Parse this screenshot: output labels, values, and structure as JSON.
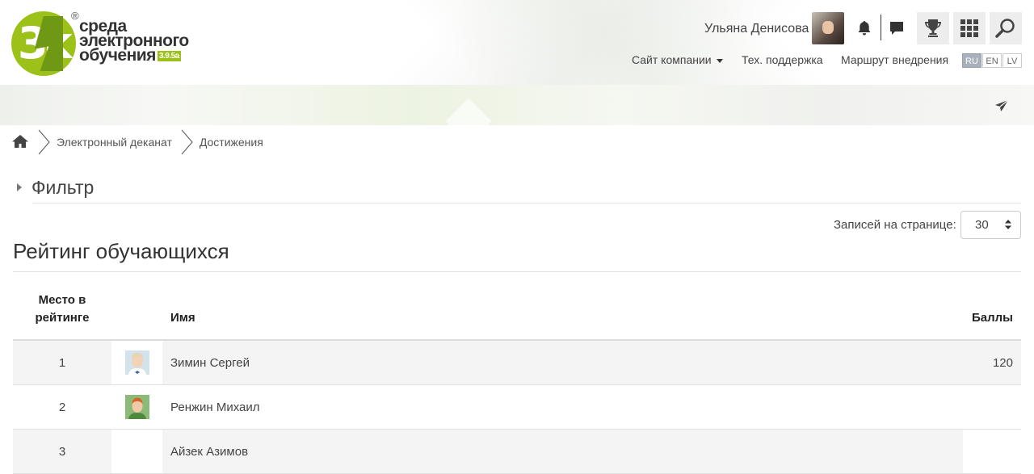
{
  "header": {
    "logo": {
      "line1": "среда",
      "line2": "электронного",
      "line3": "обучения",
      "version": "3.9.5a",
      "mark": "3k",
      "reg": "®"
    },
    "user_name": "Ульяна Денисова",
    "icons": [
      "bell-icon",
      "chat-icon",
      "trophy-icon",
      "grid-icon",
      "search-icon"
    ],
    "nav": {
      "company_site": "Сайт компании",
      "support": "Тех. поддержка",
      "route": "Маршрут внедрения"
    },
    "languages": [
      "RU",
      "EN",
      "LV"
    ],
    "active_language": "RU"
  },
  "breadcrumb": {
    "items": [
      "Электронный деканат",
      "Достижения"
    ]
  },
  "filter": {
    "title": "Фильтр"
  },
  "per_page": {
    "label": "Записей на странице:",
    "value": "30"
  },
  "rating": {
    "title": "Рейтинг обучающихся",
    "columns": {
      "place": "Место в рейтинге",
      "name": "Имя",
      "score": "Баллы"
    },
    "rows": [
      {
        "place": "1",
        "name": "Зимин Сергей",
        "score": "120"
      },
      {
        "place": "2",
        "name": "Ренжин Михаил",
        "score": ""
      },
      {
        "place": "3",
        "name": "Айзек Азимов",
        "score": ""
      }
    ]
  },
  "colors": {
    "accent": "#9cc21a",
    "accent_dark": "#6f9914",
    "lang_active": "#a8b1bb"
  }
}
